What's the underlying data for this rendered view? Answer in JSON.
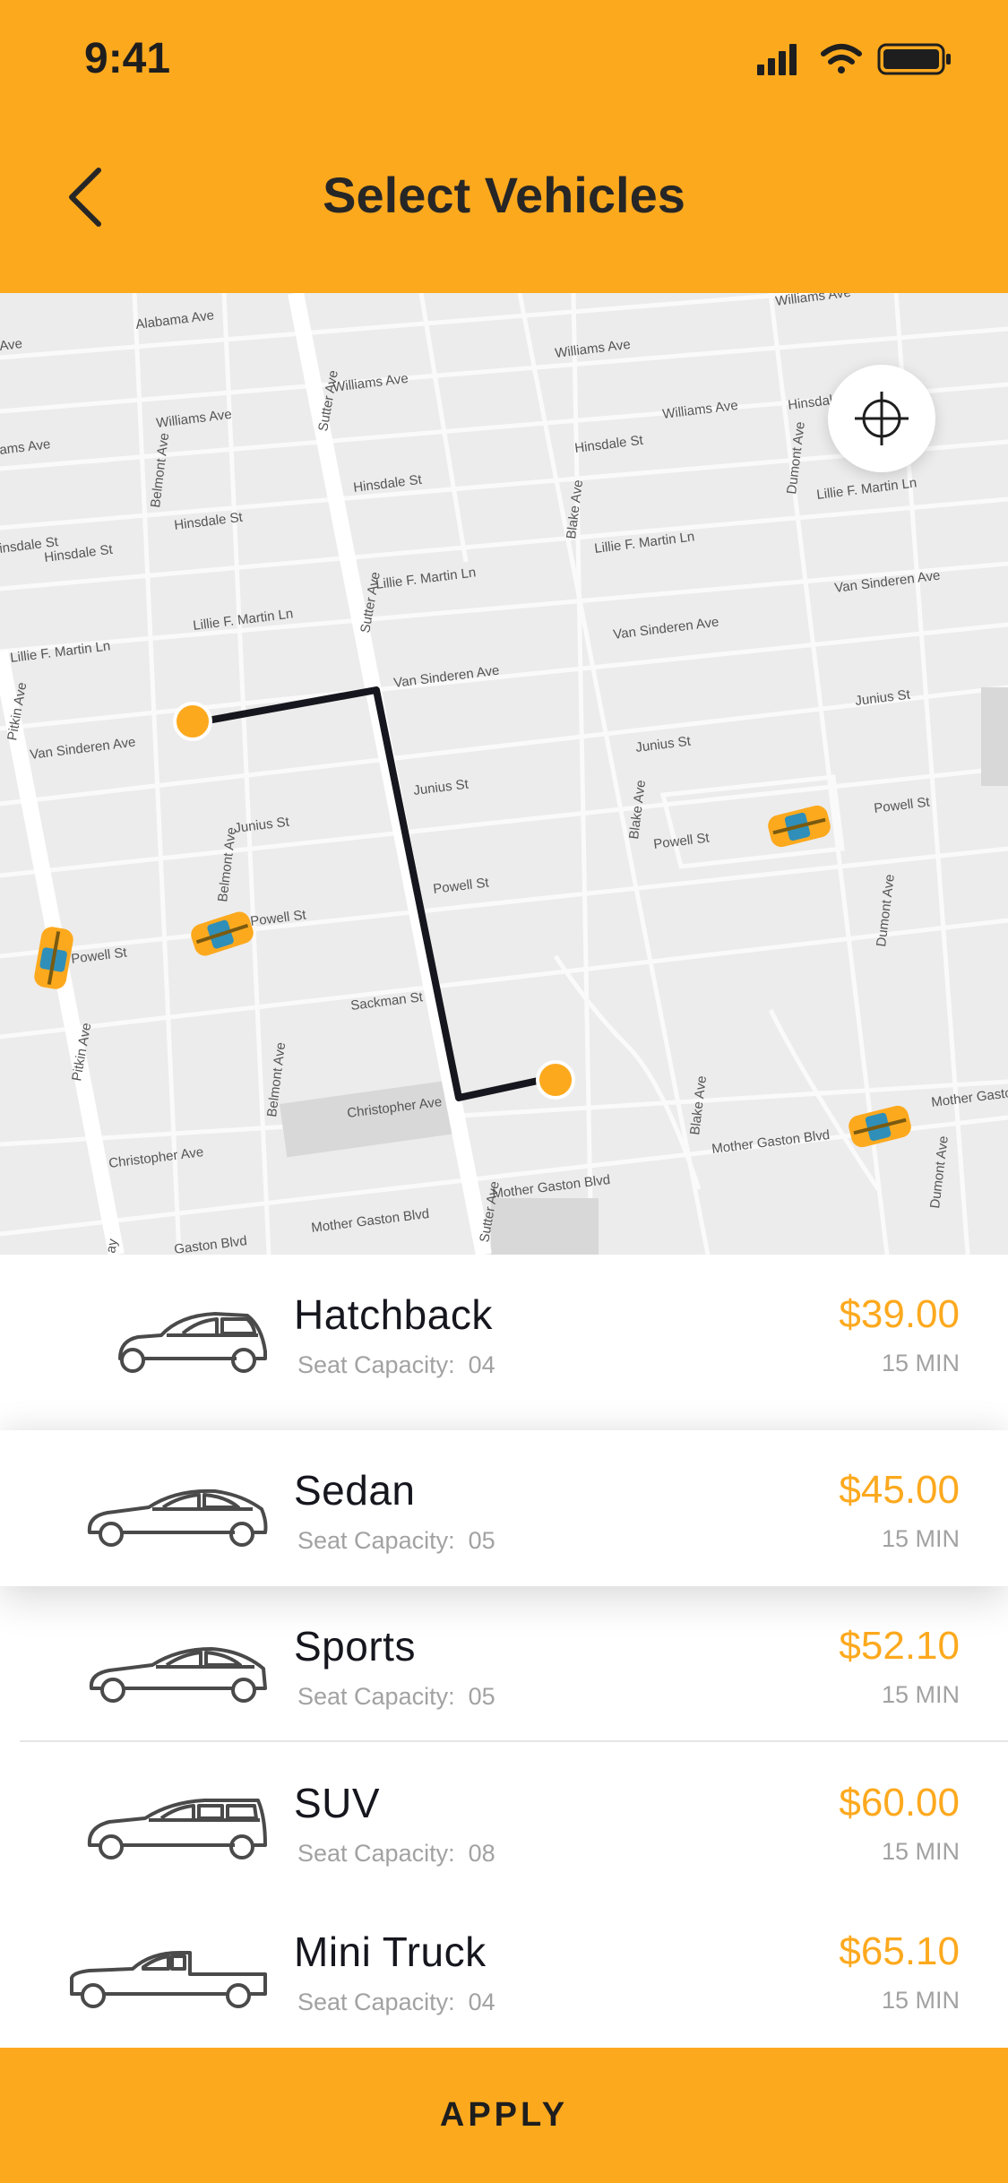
{
  "status_bar": {
    "time": "9:41"
  },
  "header": {
    "title": "Select Vehicles",
    "back_icon": "chevron-left-icon"
  },
  "colors": {
    "accent": "#FDA91E",
    "text_dark": "#16161e",
    "muted": "#a2a2a2",
    "map_bg": "#ececec"
  },
  "map": {
    "locate_icon": "crosshair-icon",
    "street_labels": [
      "Alabama Ave",
      "Williams Ave",
      "Williams Ave",
      "Williams Ave",
      "Williams Ave",
      "Williams Ave",
      "Hinsdale St",
      "Hinsdale St",
      "Hinsdale St",
      "Hinsdale St",
      "Hinsdale St",
      "Lillie F. Martin Ln",
      "Lillie F. Martin Ln",
      "Lillie F. Martin Ln",
      "Lillie F. Martin Ln",
      "Lillie F. Martin Ln",
      "Van Sinderen Ave",
      "Van Sinderen Ave",
      "Van Sinderen Ave",
      "Van Sinderen Ave",
      "Junius St",
      "Junius St",
      "Junius St",
      "Junius St",
      "Powell St",
      "Powell St",
      "Powell St",
      "Powell St",
      "Powell St",
      "Sackman St",
      "Christopher Ave",
      "Christopher Ave",
      "Mother Gaston Blvd",
      "Mother Gaston Blvd",
      "Mother Gaston Blvd",
      "Mother Gaston Blvd",
      "Gaston Blvd",
      "Sutter Ave",
      "Sutter Ave",
      "Sutter Ave",
      "Belmont Ave",
      "Belmont Ave",
      "Belmont Ave",
      "Blake Ave",
      "Blake Ave",
      "Blake Ave",
      "Dumont Ave",
      "Dumont Ave",
      "Dumont Ave",
      "Pitkin Ave",
      "Pitkin Ave",
      "ams Ave",
      "insdale St",
      "Ave",
      "ay"
    ]
  },
  "vehicles": [
    {
      "name": "Hatchback",
      "seat_label": "Seat Capacity:",
      "seats": "04",
      "price": "$39.00",
      "eta": "15 MIN",
      "icon": "hatchback-car-icon"
    },
    {
      "name": "Sedan",
      "seat_label": "Seat Capacity:",
      "seats": "05",
      "price": "$45.00",
      "eta": "15 MIN",
      "icon": "sedan-car-icon",
      "selected": true
    },
    {
      "name": "Sports",
      "seat_label": "Seat Capacity:",
      "seats": "05",
      "price": "$52.10",
      "eta": "15 MIN",
      "icon": "sports-car-icon"
    },
    {
      "name": "SUV",
      "seat_label": "Seat Capacity:",
      "seats": "08",
      "price": "$60.00",
      "eta": "15 MIN",
      "icon": "suv-car-icon"
    },
    {
      "name": "Mini Truck",
      "seat_label": "Seat Capacity:",
      "seats": "04",
      "price": "$65.10",
      "eta": "15 MIN",
      "icon": "pickup-truck-icon"
    }
  ],
  "footer": {
    "apply_label": "APPLY"
  }
}
